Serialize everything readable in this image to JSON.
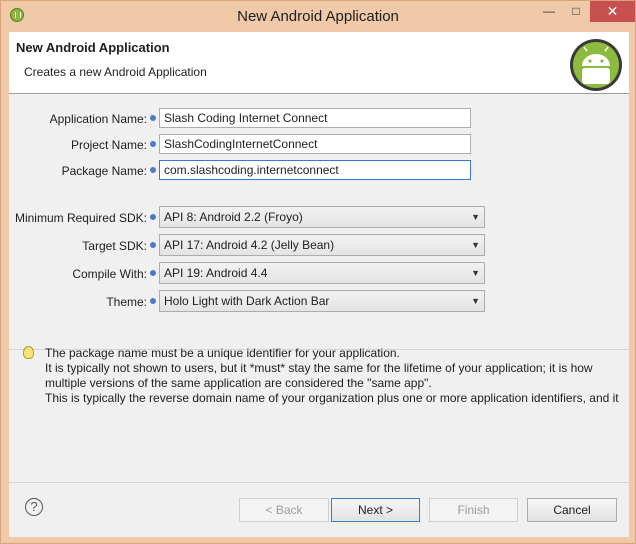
{
  "window": {
    "title": "New Android Application",
    "minimize": "—",
    "maximize": "□",
    "close": "✕"
  },
  "header": {
    "title": "New Android Application",
    "description": "Creates a new Android Application"
  },
  "form": {
    "app_name_label": "Application Name:",
    "app_name_value": "Slash Coding Internet Connect",
    "project_name_label": "Project Name:",
    "project_name_value": "SlashCodingInternetConnect",
    "package_name_label": "Package Name:",
    "package_name_value": "com.slashcoding.internetconnect",
    "min_sdk_label": "Minimum Required SDK:",
    "min_sdk_value": "API 8: Android 2.2 (Froyo)",
    "target_sdk_label": "Target SDK:",
    "target_sdk_value": "API 17: Android 4.2 (Jelly Bean)",
    "compile_with_label": "Compile With:",
    "compile_with_value": "API 19: Android 4.4",
    "theme_label": "Theme:",
    "theme_value": "Holo Light with Dark Action Bar"
  },
  "message": {
    "line1": "The package name must be a unique identifier for your application.",
    "line2": "It is typically not shown to users, but it *must* stay the same for the lifetime of your application; it is how",
    "line3": "multiple versions of the same application are considered the \"same app\".",
    "line4": "This is typically the reverse domain name of your organization plus one or more application identifiers, and it"
  },
  "buttons": {
    "help": "?",
    "back": "< Back",
    "next": "Next >",
    "finish": "Finish",
    "cancel": "Cancel"
  }
}
